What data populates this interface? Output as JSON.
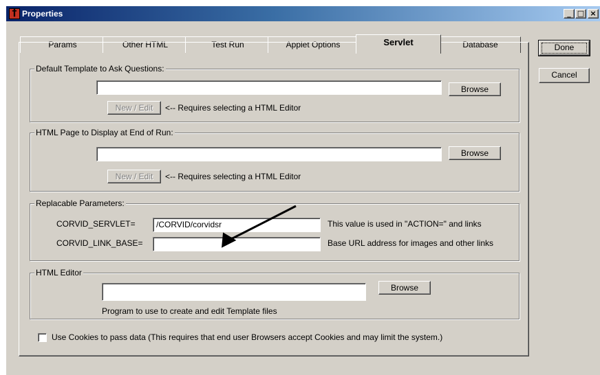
{
  "window": {
    "title": "Properties"
  },
  "caption_buttons": {
    "minimize": "_",
    "maximize": "□",
    "close": "×"
  },
  "tabs": [
    {
      "label": "Params"
    },
    {
      "label": "Other HTML"
    },
    {
      "label": "Test Run"
    },
    {
      "label": "Applet Options"
    },
    {
      "label": "Servlet"
    },
    {
      "label": "Database"
    }
  ],
  "buttons": {
    "done": "Done",
    "cancel": "Cancel"
  },
  "default_template": {
    "legend": "Default Template to Ask Questions:",
    "value": "",
    "browse_label": "Browse",
    "new_edit_label": "New / Edit",
    "hint": "<-- Requires selecting a HTML Editor"
  },
  "end_page": {
    "legend": "HTML Page to Display at End of Run:",
    "value": "",
    "browse_label": "Browse",
    "new_edit_label": "New / Edit",
    "hint": "<-- Requires selecting a HTML Editor"
  },
  "replacable": {
    "legend": "Replacable Parameters:",
    "servlet_label": "CORVID_SERVLET=",
    "servlet_value": "/CORVID/corvidsr",
    "servlet_note": "This value is used in \"ACTION=\" and links",
    "link_base_label": "CORVID_LINK_BASE=",
    "link_base_value": "",
    "link_base_note": "Base URL address for images and other links"
  },
  "html_editor": {
    "legend": "HTML Editor",
    "value": "",
    "browse_label": "Browse",
    "note": "Program to use to create and edit Template files"
  },
  "cookies": {
    "checked": false,
    "label": "Use Cookies to pass data (This requires that end user Browsers accept Cookies and may limit the system.)"
  },
  "colors": {
    "face": "#d4d0c8",
    "title_start": "#0a246a",
    "title_end": "#a6caf0"
  },
  "icons": [
    "app-icon",
    "arrow-annotation-icon",
    "checkbox-icon"
  ]
}
